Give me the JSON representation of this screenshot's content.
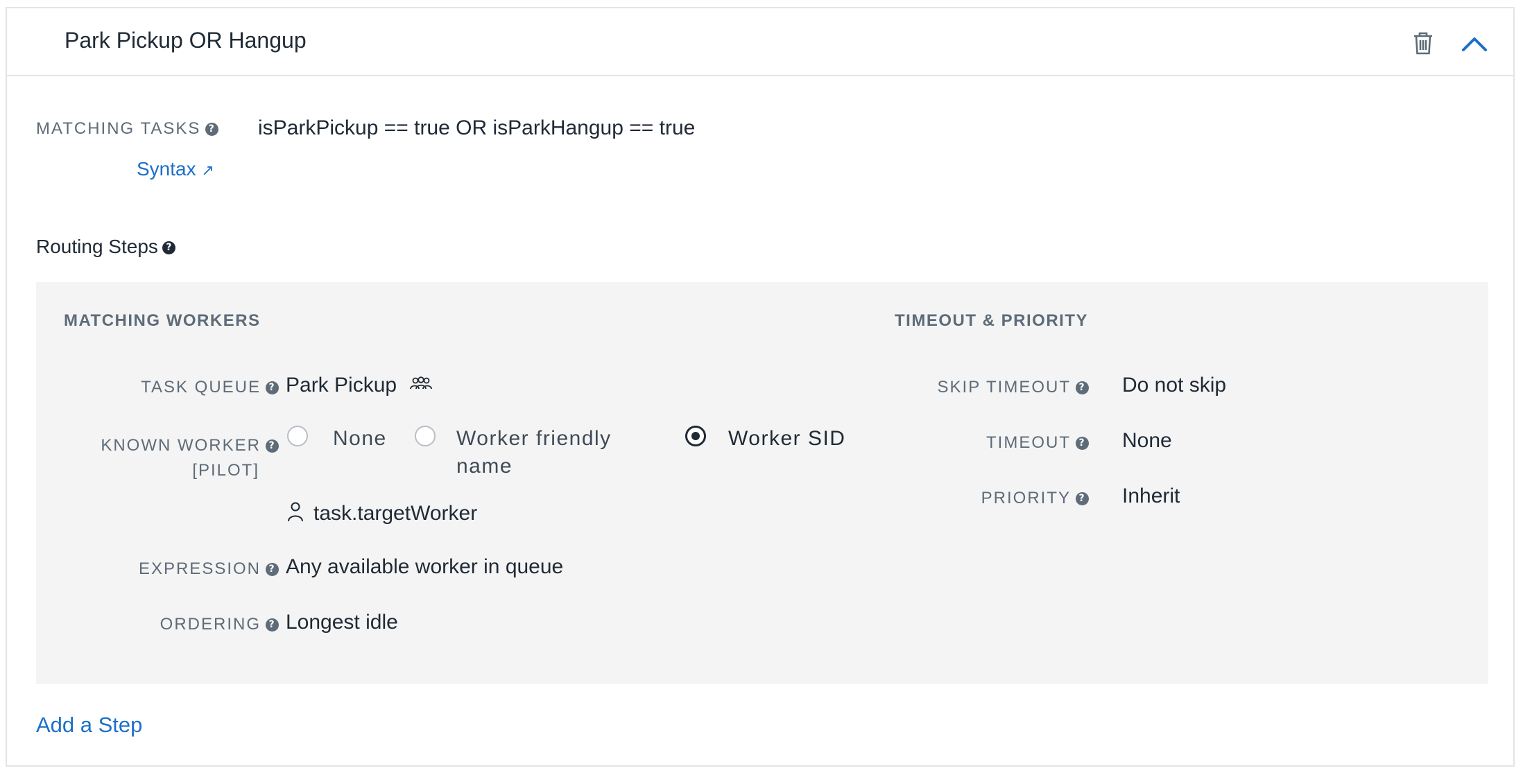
{
  "filter": {
    "title": "Park Pickup OR Hangup",
    "delete_icon": "trash-icon",
    "collapse_icon": "chevron-up-icon"
  },
  "matching_tasks": {
    "label": "MATCHING TASKS",
    "expression": "isParkPickup == true OR isParkHangup == true",
    "syntax_link": "Syntax",
    "syntax_arrow": "↗"
  },
  "routing_steps": {
    "label": "Routing Steps",
    "matching_workers": {
      "heading": "MATCHING WORKERS",
      "task_queue": {
        "label": "TASK QUEUE",
        "value": "Park Pickup",
        "icon": "users-icon"
      },
      "known_worker": {
        "label_line1": "KNOWN WORKER",
        "label_line2": "[PILOT]",
        "options": [
          {
            "label": "None",
            "selected": false
          },
          {
            "label_line1": "Worker friendly",
            "label_line2": "name",
            "selected": false
          },
          {
            "label": "Worker SID",
            "selected": true
          }
        ],
        "value": "task.targetWorker",
        "value_icon": "user-icon"
      },
      "expression": {
        "label": "EXPRESSION",
        "value": "Any available worker in queue"
      },
      "ordering": {
        "label": "ORDERING",
        "value": "Longest idle"
      }
    },
    "timeout_priority": {
      "heading": "TIMEOUT & PRIORITY",
      "skip_timeout": {
        "label": "SKIP TIMEOUT",
        "value": "Do not skip"
      },
      "timeout": {
        "label": "TIMEOUT",
        "value": "None"
      },
      "priority": {
        "label": "PRIORITY",
        "value": "Inherit"
      }
    }
  },
  "add_step": "Add a Step",
  "help_icon_glyph": "?",
  "colors": {
    "link": "#1c6fc9",
    "label": "#5e6b78",
    "panel": "#f4f4f4",
    "text": "#1f2a36"
  }
}
